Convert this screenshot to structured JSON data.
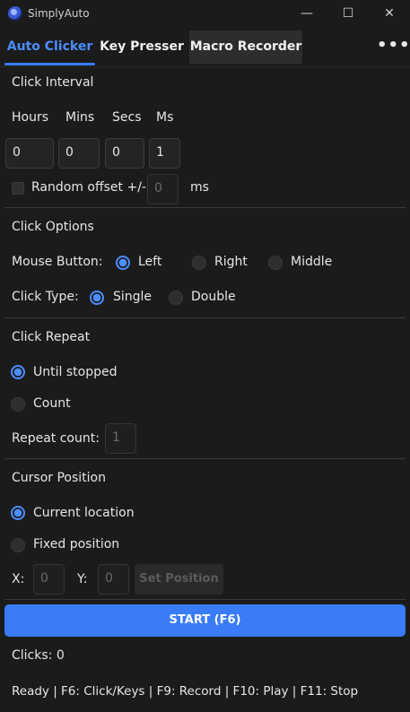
{
  "window": {
    "title": "SimplyAuto",
    "minimize": "—",
    "maximize": "☐",
    "close": "✕"
  },
  "tabs": [
    {
      "label": "Auto Clicker"
    },
    {
      "label": "Key Presser"
    },
    {
      "label": "Macro Recorder"
    }
  ],
  "tabs_more": "•••",
  "click_interval": {
    "heading": "Click Interval",
    "hours_label": "Hours",
    "mins_label": "Mins",
    "secs_label": "Secs",
    "ms_label": "Ms",
    "hours_value": "0",
    "mins_value": "0",
    "secs_value": "0",
    "ms_value": "1",
    "random_offset_label": "Random offset +/-",
    "random_offset_value": "0",
    "random_offset_unit": "ms",
    "random_offset_checked": false
  },
  "click_options": {
    "heading": "Click Options",
    "mouse_button_label": "Mouse Button:",
    "mouse_buttons": [
      "Left",
      "Right",
      "Middle"
    ],
    "mouse_button_selected": "Left",
    "click_type_label": "Click Type:",
    "click_types": [
      "Single",
      "Double"
    ],
    "click_type_selected": "Single"
  },
  "click_repeat": {
    "heading": "Click Repeat",
    "until_stopped": "Until stopped",
    "count": "Count",
    "selected": "Until stopped",
    "repeat_count_label": "Repeat count:",
    "repeat_count_value": "1"
  },
  "cursor_position": {
    "heading": "Cursor Position",
    "current_location": "Current location",
    "fixed_position": "Fixed position",
    "selected": "Current location",
    "x_label": "X:",
    "x_value": "0",
    "y_label": "Y:",
    "y_value": "0",
    "set_position_label": "Set Position"
  },
  "start_button": "START (F6)",
  "clicks_status": "Clicks: 0",
  "status_bar": "Ready | F6: Click/Keys | F9: Record | F10: Play | F11: Stop",
  "colors": {
    "accent": "#3a7bf7",
    "background": "#1b1b1b",
    "radio_selected": "#4c8dff"
  },
  "icons": {
    "app": "app-logo-icon",
    "more": "more-horizontal-icon"
  }
}
